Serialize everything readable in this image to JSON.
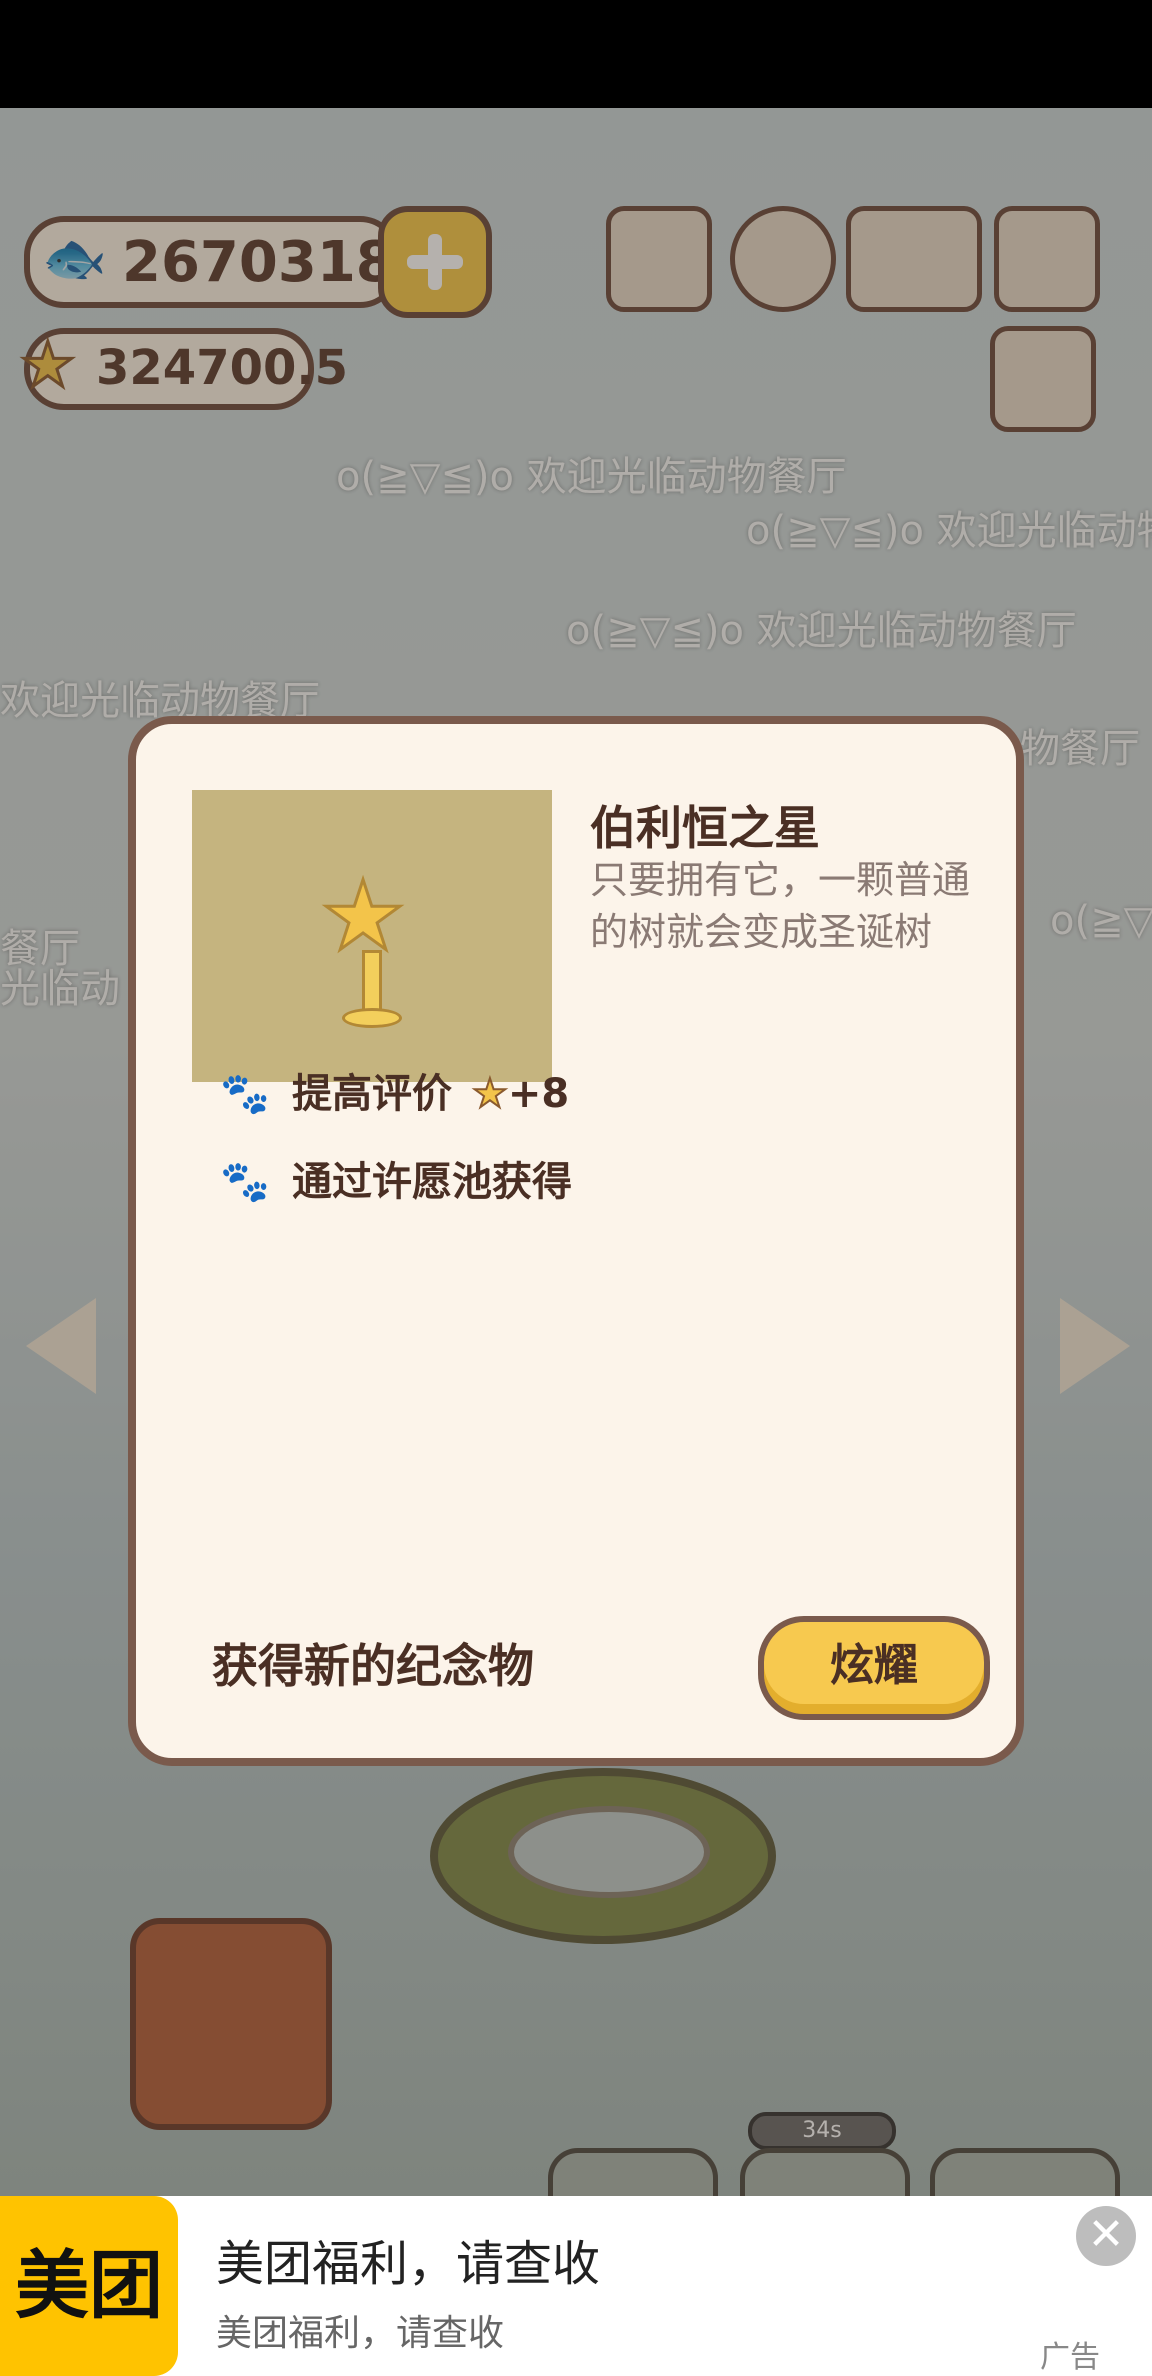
{
  "hud": {
    "fish_value": "2670318",
    "star_value": "324700.5"
  },
  "marquee_texts": [
    "o(≧▽≦)o 欢迎光临动物餐厅",
    "o(≧▽≦)o 欢迎光临动物餐",
    "o(≧▽≦)o 欢迎光临动物餐厅",
    "欢迎光临动物餐厅",
    "物餐厅",
    "餐厅",
    "光临动",
    "o(≧▽"
  ],
  "dialog": {
    "title": "伯利恒之星",
    "description": "只要拥有它，一颗普通的树就会变成圣诞树",
    "attributes": [
      {
        "label": "提高评价",
        "value": "+8"
      },
      {
        "label": "通过许愿池获得"
      }
    ],
    "footer_label": "获得新的纪念物",
    "show_button": "炫耀"
  },
  "timer": "34s",
  "ad": {
    "logo": "美团",
    "title": "美团福利，请查收",
    "subtitle": "美团福利，请查收",
    "tag": "广告",
    "close_symbol": "✕"
  },
  "colors": {
    "accent_yellow": "#f7c94f",
    "border_brown": "#7a5a4c",
    "dialog_bg": "#fcf4ea",
    "meituan_yellow": "#ffc300"
  }
}
